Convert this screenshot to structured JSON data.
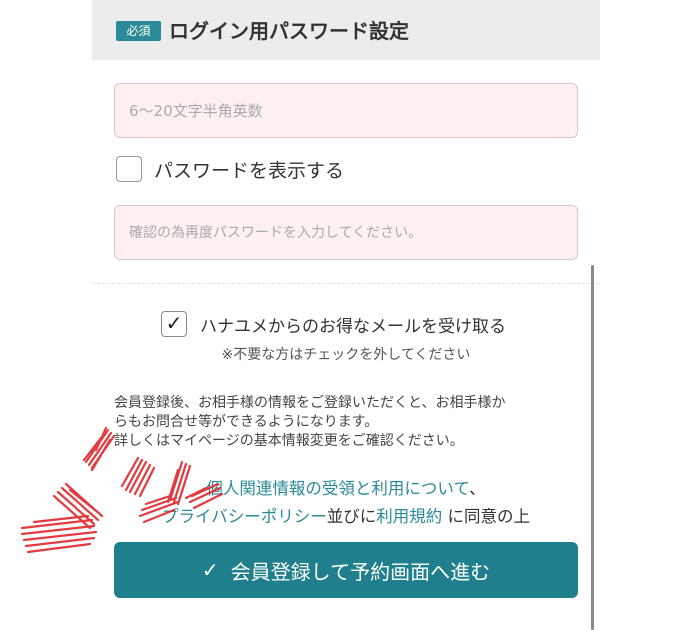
{
  "section": {
    "badge": "必須",
    "title": "ログイン用パスワード設定"
  },
  "password": {
    "placeholder": "6〜20文字半角英数",
    "value": ""
  },
  "show_password": {
    "label": "パスワードを表示する",
    "checked": false
  },
  "confirm": {
    "placeholder": "確認の為再度パスワードを入力してください。",
    "value": ""
  },
  "newsletter": {
    "label": "ハナユメからのお得なメールを受け取る",
    "checked": true,
    "check_glyph": "✓",
    "note": "※不要な方はチェックを外してください"
  },
  "info": {
    "lines": [
      "会員登録後、お相手様の情報をご登録いただくと、お相手様か",
      "らもお問合せ等ができるようになります。",
      "詳しくはマイページの基本情報変更をご確認ください。"
    ]
  },
  "consent": {
    "link_personal": "個人関連情報の受領と利用について",
    "comma": "、",
    "link_privacy": "プライバシーポリシー",
    "and_text": "並びに",
    "link_terms": "利用規約",
    "agree_text": "に同意の上"
  },
  "submit": {
    "icon": "✓",
    "label": "会員登録して予約画面へ進む"
  },
  "colors": {
    "accent": "#1f7f8c",
    "link": "#2b8a97",
    "input_bg": "#fdf0f1",
    "annotation": "#e0262b"
  },
  "icons": [
    "checkmark-icon",
    "check-icon"
  ]
}
